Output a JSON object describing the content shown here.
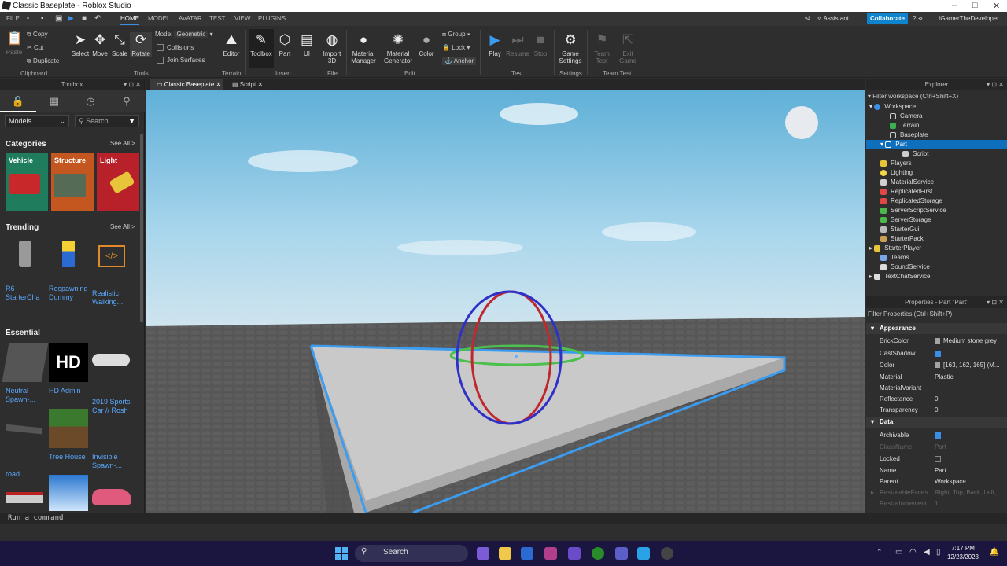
{
  "window": {
    "title": "Classic Baseplate - Roblox Studio"
  },
  "menu": {
    "file": "FILE",
    "tabs": [
      "HOME",
      "MODEL",
      "AVATAR",
      "TEST",
      "VIEW",
      "PLUGINS"
    ],
    "assistant": "Assistant",
    "collaborate": "Collaborate",
    "user": "IGamerTheDeveloper"
  },
  "ribbon": {
    "clipboard": {
      "paste": "Paste",
      "copy": "Copy",
      "cut": "Cut",
      "duplicate": "Duplicate",
      "group": "Clipboard"
    },
    "tools": {
      "select": "Select",
      "move": "Move",
      "scale": "Scale",
      "rotate": "Rotate",
      "mode_label": "Mode:",
      "mode_value": "Geometric",
      "collisions": "Collisions",
      "join": "Join Surfaces",
      "group": "Tools"
    },
    "terrain": {
      "editor": "Editor",
      "group": "Terrain"
    },
    "insert": {
      "toolbox": "Toolbox",
      "part": "Part",
      "ui": "UI",
      "group": "Insert"
    },
    "file": {
      "import": "Import 3D",
      "group": "File"
    },
    "edit": {
      "material_manager": "Material Manager",
      "material_generator": "Material Generator",
      "color": "Color",
      "group_btn": "Group",
      "lock": "Lock",
      "anchor": "Anchor",
      "group": "Edit"
    },
    "test": {
      "play": "Play",
      "resume": "Resume",
      "stop": "Stop",
      "group": "Test"
    },
    "settings": {
      "game_settings": "Game Settings",
      "group": "Settings"
    },
    "team_test": {
      "team_test": "Team Test",
      "exit_game": "Exit Game",
      "group": "Team Test"
    }
  },
  "toolbox": {
    "title": "Toolbox",
    "dropdown": "Models",
    "search_placeholder": "Search",
    "categories_title": "Categories",
    "see_all": "See All >",
    "categories": [
      {
        "label": "Vehicle",
        "color": "#1f7d5e"
      },
      {
        "label": "Structure",
        "color": "#c4561f"
      },
      {
        "label": "Light",
        "color": "#b8202a"
      }
    ],
    "trending_title": "Trending",
    "trending": [
      "R6 StarterCha",
      "Respawning Dummy",
      "Realistic Walking..."
    ],
    "essential_title": "Essential",
    "essential": [
      "Neutral Spawn-...",
      "HD Admin",
      "2019 Sports Car // Rosh",
      "road",
      "Tree House",
      "Invisible Spawn-..."
    ]
  },
  "tabs": [
    "Classic Baseplate",
    "Script"
  ],
  "explorer": {
    "title": "Explorer",
    "filter": "Filter workspace (Ctrl+Shift+X)",
    "items": [
      "Workspace",
      "Camera",
      "Terrain",
      "Baseplate",
      "Part",
      "Script",
      "Players",
      "Lighting",
      "MaterialService",
      "ReplicatedFirst",
      "ReplicatedStorage",
      "ServerScriptService",
      "ServerStorage",
      "StarterGui",
      "StarterPack",
      "StarterPlayer",
      "Teams",
      "SoundService",
      "TextChatService"
    ]
  },
  "properties": {
    "title": "Properties - Part \"Part\"",
    "filter": "Filter Properties (Ctrl+Shift+P)",
    "appearance": "Appearance",
    "rows": [
      {
        "k": "BrickColor",
        "v": "Medium stone grey"
      },
      {
        "k": "CastShadow",
        "v": ""
      },
      {
        "k": "Color",
        "v": "[163, 162, 165] (M..."
      },
      {
        "k": "Material",
        "v": "Plastic"
      },
      {
        "k": "MaterialVariant",
        "v": ""
      },
      {
        "k": "Reflectance",
        "v": "0"
      },
      {
        "k": "Transparency",
        "v": "0"
      }
    ],
    "data": "Data",
    "data_rows": [
      {
        "k": "Archivable",
        "v": ""
      },
      {
        "k": "ClassName",
        "v": "Part"
      },
      {
        "k": "Locked",
        "v": ""
      },
      {
        "k": "Name",
        "v": "Part"
      },
      {
        "k": "Parent",
        "v": "Workspace"
      },
      {
        "k": "ResizeableFaces",
        "v": "Right, Top, Back, Left,..."
      },
      {
        "k": "ResizeIncrement",
        "v": "1"
      }
    ]
  },
  "command": {
    "placeholder": "Run a command"
  },
  "taskbar": {
    "search": "Search",
    "time": "7:17 PM",
    "date": "12/23/2023"
  }
}
